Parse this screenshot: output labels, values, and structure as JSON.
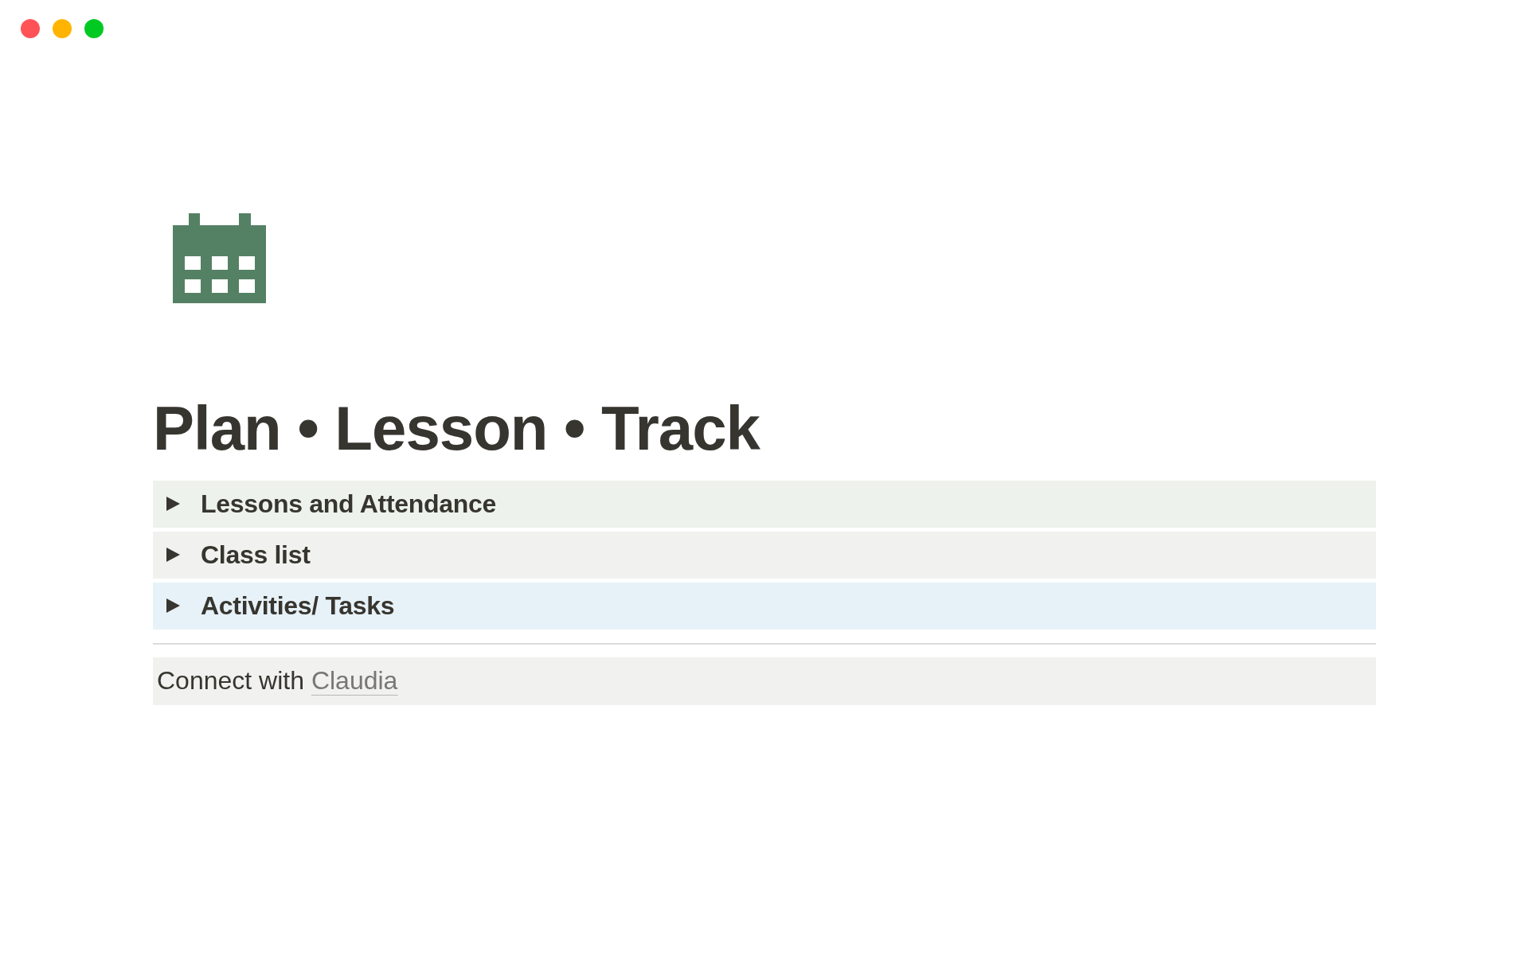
{
  "window_controls": [
    {
      "color": "#ff5257"
    },
    {
      "color": "#ffb401"
    },
    {
      "color": "#00c922"
    }
  ],
  "page": {
    "title": "Plan • Lesson • Track",
    "toggles": [
      {
        "label": "Lessons and Attendance",
        "expanded": false,
        "color": "#edf3ec"
      },
      {
        "label": "Class list",
        "expanded": false,
        "color": "#f1f1ef"
      },
      {
        "label": "Activities/ Tasks",
        "expanded": false,
        "color": "#e7f2f8"
      }
    ],
    "callout": {
      "text": "Connect with",
      "link": "Claudia"
    }
  }
}
